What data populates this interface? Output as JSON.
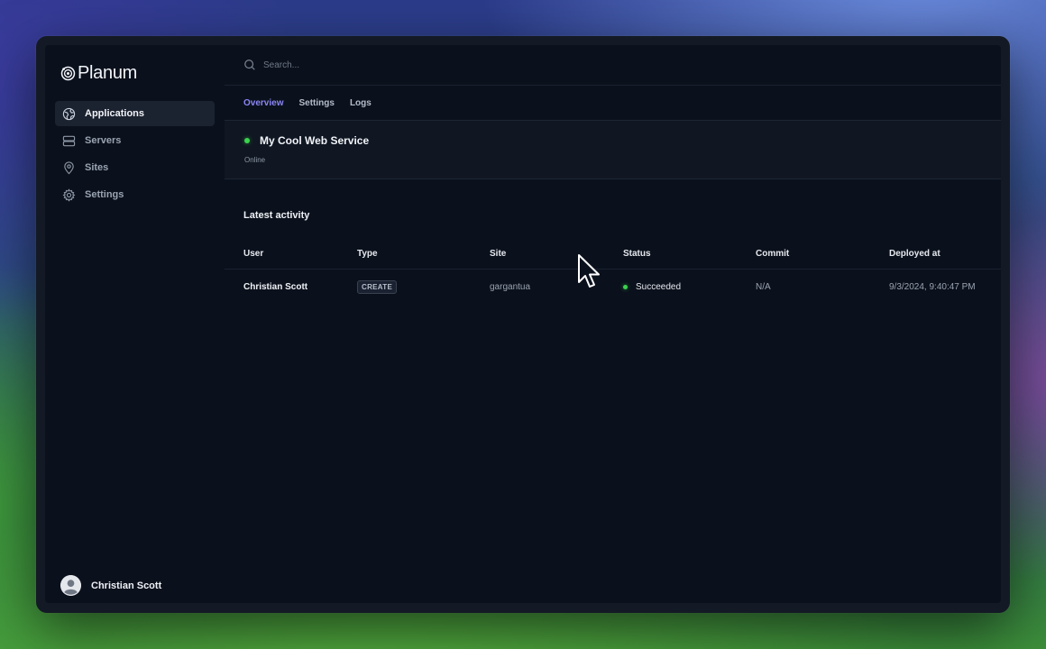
{
  "brand": {
    "name": "Planum"
  },
  "sidebar": {
    "items": [
      {
        "label": "Applications",
        "icon": "globe-icon",
        "active": true
      },
      {
        "label": "Servers",
        "icon": "server-icon",
        "active": false
      },
      {
        "label": "Sites",
        "icon": "map-pin-icon",
        "active": false
      },
      {
        "label": "Settings",
        "icon": "gear-icon",
        "active": false
      }
    ],
    "user": {
      "name": "Christian Scott",
      "icon": "user-avatar-icon"
    }
  },
  "search": {
    "placeholder": "Search...",
    "icon": "search-icon"
  },
  "tabs": [
    {
      "label": "Overview",
      "active": true
    },
    {
      "label": "Settings",
      "active": false
    },
    {
      "label": "Logs",
      "active": false
    }
  ],
  "app_card": {
    "title": "My Cool Web Service",
    "status": "Online",
    "status_color": "#3bd24d"
  },
  "activity": {
    "title": "Latest activity",
    "columns": [
      "User",
      "Type",
      "Site",
      "Status",
      "Commit",
      "Deployed at"
    ],
    "rows": [
      {
        "user": "Christian Scott",
        "type": "CREATE",
        "site": "gargantua",
        "status": "Succeeded",
        "commit": "N/A",
        "deployed_at": "9/3/2024, 9:40:47 PM"
      }
    ]
  },
  "colors": {
    "accent": "#8b86f5",
    "success": "#3bd24d",
    "background": "#0b111c"
  }
}
